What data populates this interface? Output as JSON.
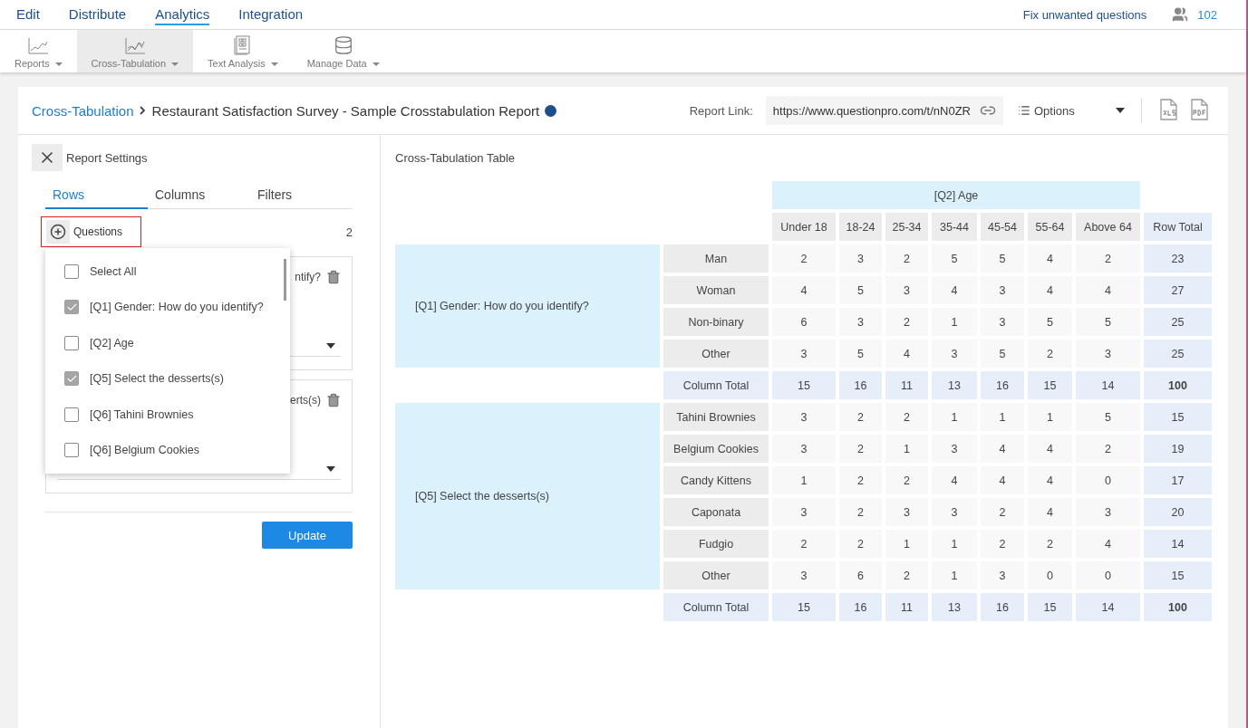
{
  "nav": {
    "tabs": [
      {
        "label": "Edit",
        "selected": false
      },
      {
        "label": "Distribute",
        "selected": false
      },
      {
        "label": "Analytics",
        "selected": true
      },
      {
        "label": "Integration",
        "selected": false
      }
    ],
    "fix_link": "Fix unwanted questions",
    "user_count": "102"
  },
  "toolbar": [
    {
      "label": "Reports",
      "kind": "line",
      "selected": false
    },
    {
      "label": "Cross-Tabulation",
      "kind": "multiline",
      "selected": true
    },
    {
      "label": "Text Analysis",
      "kind": "document",
      "selected": false
    },
    {
      "label": "Manage Data",
      "kind": "database",
      "selected": false
    }
  ],
  "header": {
    "breadcrumb_link": "Cross-Tabulation",
    "title": "Restaurant Satisfaction Survey - Sample Crosstabulation Report",
    "report_link_label": "Report Link:",
    "report_link": "https://www.questionpro.com/t/nN0ZR",
    "options": "Options"
  },
  "settings": {
    "title": "Report Settings",
    "tabs": [
      {
        "label": "Rows",
        "selected": true
      },
      {
        "label": "Columns",
        "selected": false
      },
      {
        "label": "Filters",
        "selected": false
      }
    ],
    "questions_label": "Questions",
    "questions_count": "2",
    "cards": [
      {
        "text": "ntify?"
      },
      {
        "text": "erts(s)"
      }
    ],
    "dropdown": [
      {
        "label": "Select All",
        "checked": false
      },
      {
        "label": "[Q1] Gender: How do you identify?",
        "checked": true
      },
      {
        "label": "[Q2] Age",
        "checked": false
      },
      {
        "label": "[Q5] Select the desserts(s)",
        "checked": true
      },
      {
        "label": "[Q6] Tahini Brownies",
        "checked": false
      },
      {
        "label": "[Q6] Belgium Cookies",
        "checked": false
      }
    ],
    "update": "Update"
  },
  "table": {
    "title": "Cross-Tabulation Table",
    "column_group": "[Q2] Age",
    "columns": [
      "Under 18",
      "18-24",
      "25-34",
      "35-44",
      "45-54",
      "55-64",
      "Above 64",
      "Row Total"
    ],
    "groups": [
      {
        "question": "[Q1] Gender: How do you identify?",
        "rows": [
          {
            "label": "Man",
            "values": [
              "2",
              "3",
              "2",
              "5",
              "5",
              "4",
              "2",
              "23"
            ]
          },
          {
            "label": "Woman",
            "values": [
              "4",
              "5",
              "3",
              "4",
              "3",
              "4",
              "4",
              "27"
            ]
          },
          {
            "label": "Non-binary",
            "values": [
              "6",
              "3",
              "2",
              "1",
              "3",
              "5",
              "5",
              "25"
            ]
          },
          {
            "label": "Other",
            "values": [
              "3",
              "5",
              "4",
              "3",
              "5",
              "2",
              "3",
              "25"
            ]
          }
        ],
        "total": {
          "label": "Column Total",
          "values": [
            "15",
            "16",
            "11",
            "13",
            "16",
            "15",
            "14",
            "100"
          ]
        }
      },
      {
        "question": "[Q5] Select the desserts(s)",
        "rows": [
          {
            "label": "Tahini Brownies",
            "values": [
              "3",
              "2",
              "2",
              "1",
              "1",
              "1",
              "5",
              "15"
            ]
          },
          {
            "label": "Belgium Cookies",
            "values": [
              "3",
              "2",
              "1",
              "3",
              "4",
              "4",
              "2",
              "19"
            ]
          },
          {
            "label": "Candy Kittens",
            "values": [
              "1",
              "2",
              "2",
              "4",
              "4",
              "4",
              "0",
              "17"
            ]
          },
          {
            "label": "Caponata",
            "values": [
              "3",
              "2",
              "3",
              "3",
              "2",
              "4",
              "3",
              "20"
            ]
          },
          {
            "label": "Fudgio",
            "values": [
              "2",
              "2",
              "1",
              "1",
              "2",
              "2",
              "4",
              "14"
            ]
          },
          {
            "label": "Other",
            "values": [
              "3",
              "6",
              "2",
              "1",
              "3",
              "0",
              "0",
              "15"
            ]
          }
        ],
        "total": {
          "label": "Column Total",
          "values": [
            "15",
            "16",
            "11",
            "13",
            "16",
            "15",
            "14",
            "100"
          ]
        }
      }
    ]
  }
}
